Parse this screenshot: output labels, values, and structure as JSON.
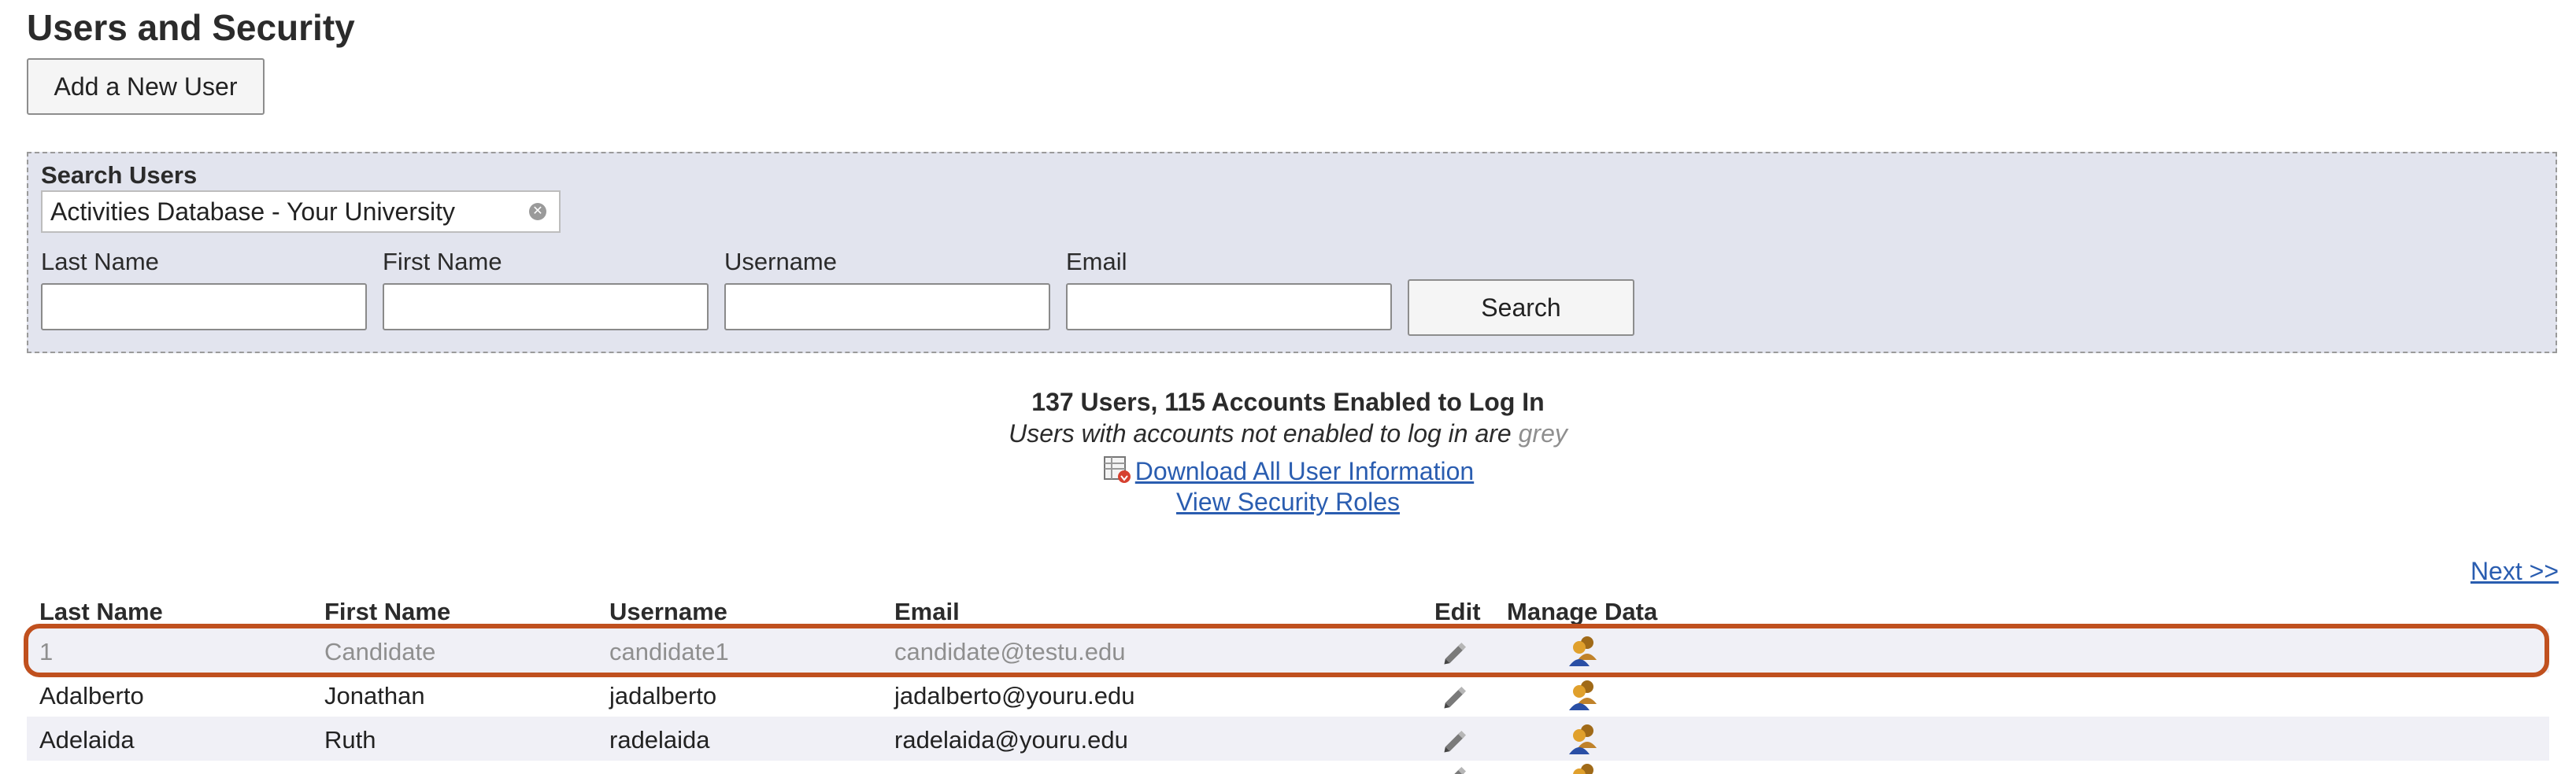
{
  "page": {
    "title": "Users and Security"
  },
  "actions": {
    "add_user_label": "Add a New User"
  },
  "search": {
    "panel_title": "Search Users",
    "database_selected": "Activities Database - Your University",
    "fields": {
      "last_name_label": "Last Name",
      "first_name_label": "First Name",
      "username_label": "Username",
      "email_label": "Email"
    },
    "search_button_label": "Search"
  },
  "summary": {
    "count_text": "137 Users, 115 Accounts Enabled to Log In",
    "note_text": "Users with accounts not enabled to log in are ",
    "note_grey_word": "grey",
    "download_link": "Download All User Information",
    "roles_link": "View Security Roles"
  },
  "pagination": {
    "next_label": "Next >>"
  },
  "table": {
    "headers": {
      "last_name": "Last Name",
      "first_name": "First Name",
      "username": "Username",
      "email": "Email",
      "edit": "Edit",
      "manage_data": "Manage Data"
    },
    "rows": [
      {
        "last_name": "1",
        "first_name": "Candidate",
        "username": "candidate1",
        "email": "candidate@testu.edu",
        "enabled": false
      },
      {
        "last_name": "Adalberto",
        "first_name": "Jonathan",
        "username": "jadalberto",
        "email": "jadalberto@youru.edu",
        "enabled": true
      },
      {
        "last_name": "Adelaida",
        "first_name": "Ruth",
        "username": "radelaida",
        "email": "radelaida@youru.edu",
        "enabled": true
      }
    ]
  },
  "icons": {
    "edit": "pencil-icon",
    "manage_data": "users-group-icon",
    "download": "spreadsheet-icon",
    "clear": "clear-selection-icon"
  },
  "colors": {
    "panel_background": "#e2e4ee",
    "link": "#2a5db0",
    "highlight": "#c0501e",
    "disabled_text": "#8f8f8f"
  }
}
